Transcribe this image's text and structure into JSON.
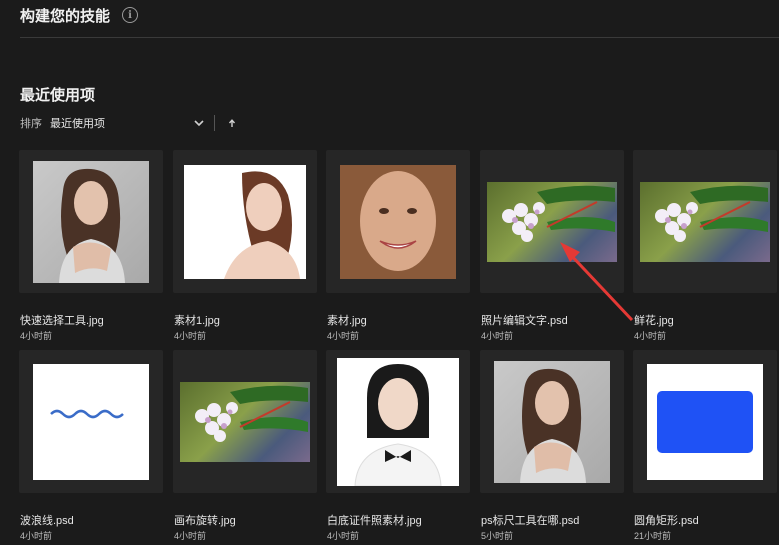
{
  "header": {
    "title": "构建您的技能",
    "info_icon": "i"
  },
  "recent": {
    "title": "最近使用项",
    "sort_label": "排序",
    "sort_value": "最近使用项"
  },
  "files": [
    {
      "name": "快速选择工具.jpg",
      "time": "4小时前",
      "thumb": "woman-gray"
    },
    {
      "name": "素材1.jpg",
      "time": "4小时前",
      "thumb": "woman-white"
    },
    {
      "name": "素材.jpg",
      "time": "4小时前",
      "thumb": "face"
    },
    {
      "name": "照片编辑文字.psd",
      "time": "4小时前",
      "thumb": "flower"
    },
    {
      "name": "鲜花.jpg",
      "time": "4小时前",
      "thumb": "flower"
    },
    {
      "name": "波浪线.psd",
      "time": "4小时前",
      "thumb": "wave"
    },
    {
      "name": "画布旋转.jpg",
      "time": "4小时前",
      "thumb": "flower"
    },
    {
      "name": "白底证件照素材.jpg",
      "time": "4小时前",
      "thumb": "id-photo"
    },
    {
      "name": "ps标尺工具在哪.psd",
      "time": "5小时前",
      "thumb": "woman-gray"
    },
    {
      "name": "圆角矩形.psd",
      "time": "21小时前",
      "thumb": "blue-rect"
    }
  ],
  "colors": {
    "background": "#1b1b1b",
    "card": "#262626",
    "annotation_arrow": "#e53935",
    "blue_rect": "#1f52f5"
  }
}
